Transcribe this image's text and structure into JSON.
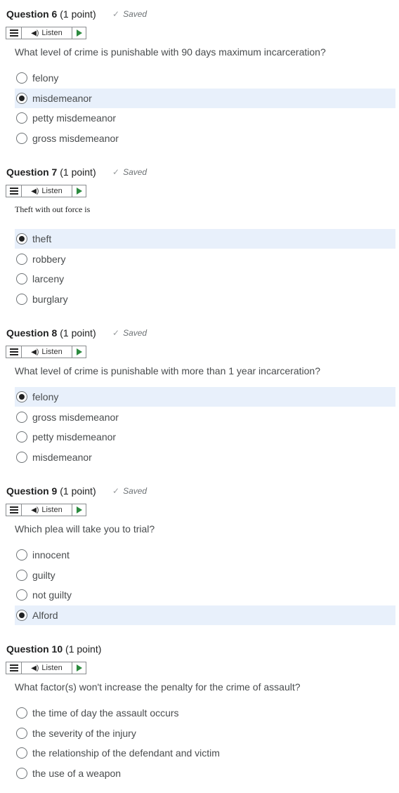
{
  "listen_label": "Listen",
  "questions": [
    {
      "number_label": "Question 6",
      "points_label": "(1 point)",
      "saved_label": "Saved",
      "prompt": "What level of crime is punishable with 90 days maximum incarceration?",
      "options": [
        {
          "label": "felony",
          "selected": false
        },
        {
          "label": "misdemeanor",
          "selected": true
        },
        {
          "label": "petty misdemeanor",
          "selected": false
        },
        {
          "label": "gross misdemeanor",
          "selected": false
        }
      ]
    },
    {
      "number_label": "Question 7",
      "points_label": "(1 point)",
      "saved_label": "Saved",
      "prompt": "Theft with out force is",
      "options": [
        {
          "label": "theft",
          "selected": true
        },
        {
          "label": "robbery",
          "selected": false
        },
        {
          "label": "larceny",
          "selected": false
        },
        {
          "label": "burglary",
          "selected": false
        }
      ]
    },
    {
      "number_label": "Question 8",
      "points_label": "(1 point)",
      "saved_label": "Saved",
      "prompt": "What level of crime is punishable with more than 1 year incarceration?",
      "options": [
        {
          "label": "felony",
          "selected": true
        },
        {
          "label": "gross misdemeanor",
          "selected": false
        },
        {
          "label": "petty misdemeanor",
          "selected": false
        },
        {
          "label": "misdemeanor",
          "selected": false
        }
      ]
    },
    {
      "number_label": "Question 9",
      "points_label": "(1 point)",
      "saved_label": "Saved",
      "prompt": "Which plea will take you to trial?",
      "options": [
        {
          "label": "innocent",
          "selected": false
        },
        {
          "label": "guilty",
          "selected": false
        },
        {
          "label": "not guilty",
          "selected": false
        },
        {
          "label": "Alford",
          "selected": true
        }
      ]
    },
    {
      "number_label": "Question 10",
      "points_label": "(1 point)",
      "saved_label": "",
      "prompt": "What factor(s) won't increase the penalty for the crime of assault?",
      "options": [
        {
          "label": "the time of day the assault occurs",
          "selected": false
        },
        {
          "label": "the severity of the injury",
          "selected": false
        },
        {
          "label": "the relationship of the defendant and victim",
          "selected": false
        },
        {
          "label": "the use of a weapon",
          "selected": false
        }
      ]
    }
  ]
}
